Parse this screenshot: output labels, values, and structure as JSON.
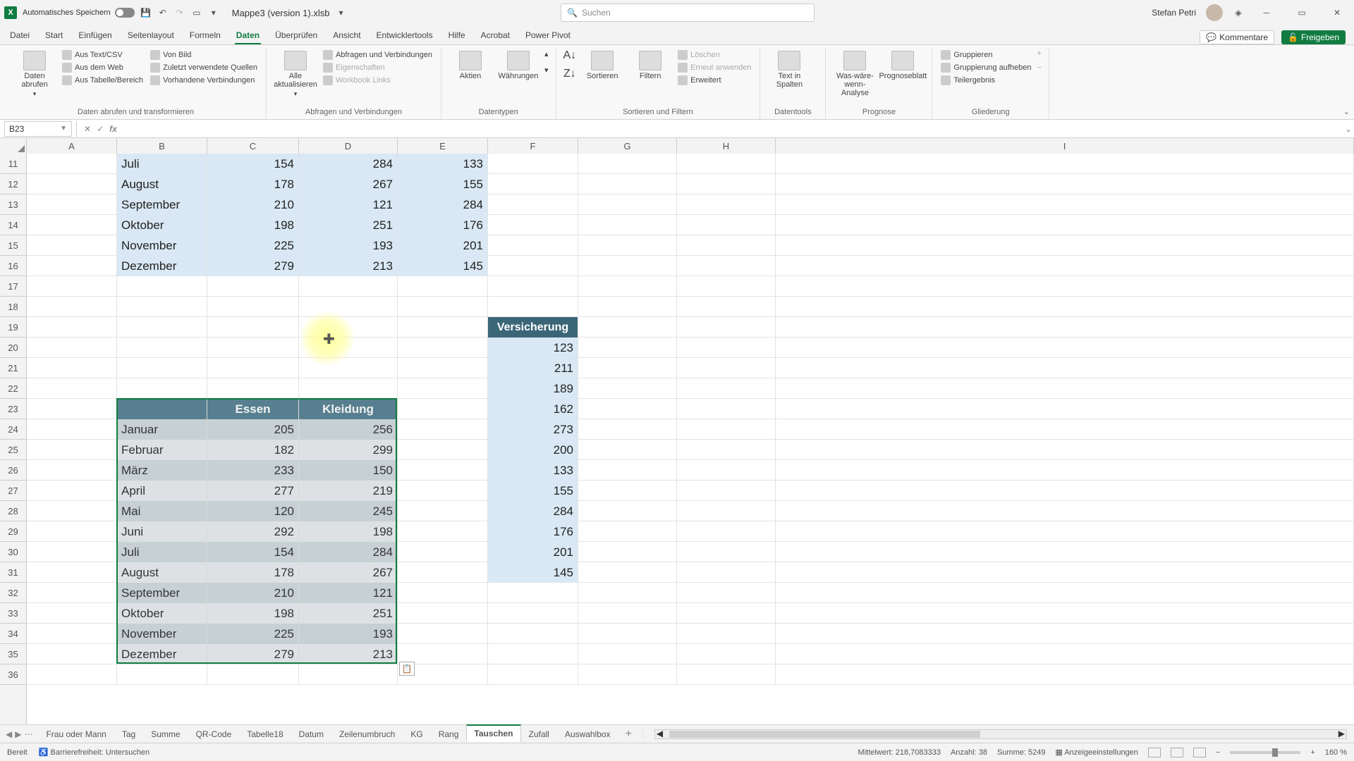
{
  "title": {
    "autosave_label": "Automatisches Speichern",
    "document_name": "Mappe3 (version 1).xlsb",
    "search_placeholder": "Suchen",
    "user_name": "Stefan Petri"
  },
  "menu": {
    "tabs": [
      "Datei",
      "Start",
      "Einfügen",
      "Seitenlayout",
      "Formeln",
      "Daten",
      "Überprüfen",
      "Ansicht",
      "Entwicklertools",
      "Hilfe",
      "Acrobat",
      "Power Pivot"
    ],
    "active_index": 5,
    "comments": "Kommentare",
    "share": "Freigeben"
  },
  "ribbon": {
    "g0_big": "Daten abrufen",
    "g0_items": [
      "Aus Text/CSV",
      "Aus dem Web",
      "Aus Tabelle/Bereich",
      "Von Bild",
      "Zuletzt verwendete Quellen",
      "Vorhandene Verbindungen"
    ],
    "g0_label": "Daten abrufen und transformieren",
    "g1_big": "Alle aktualisieren",
    "g1_items": [
      "Abfragen und Verbindungen",
      "Eigenschaften",
      "Workbook Links"
    ],
    "g1_label": "Abfragen und Verbindungen",
    "g2_items": [
      "Aktien",
      "Währungen"
    ],
    "g2_label": "Datentypen",
    "g3_sort": "Sortieren",
    "g3_filter": "Filtern",
    "g3_items": [
      "Löschen",
      "Erneut anwenden",
      "Erweitert"
    ],
    "g3_label": "Sortieren und Filtern",
    "g4_big": "Text in Spalten",
    "g4_label": "Datentools",
    "g5_a": "Was-wäre-wenn-Analyse",
    "g5_b": "Prognoseblatt",
    "g5_label": "Prognose",
    "g6_items": [
      "Gruppieren",
      "Gruppierung aufheben",
      "Teilergebnis"
    ],
    "g6_label": "Gliederung"
  },
  "fx": {
    "namebox": "B23"
  },
  "columns": [
    "A",
    "B",
    "C",
    "D",
    "E",
    "F",
    "G",
    "H",
    "I"
  ],
  "row_start": 11,
  "row_count": 26,
  "top_table": {
    "rows": [
      {
        "m": "Juli",
        "c": 154,
        "d": 284,
        "e": 133
      },
      {
        "m": "August",
        "c": 178,
        "d": 267,
        "e": 155
      },
      {
        "m": "September",
        "c": 210,
        "d": 121,
        "e": 284
      },
      {
        "m": "Oktober",
        "c": 198,
        "d": 251,
        "e": 176
      },
      {
        "m": "November",
        "c": 225,
        "d": 193,
        "e": 201
      },
      {
        "m": "Dezember",
        "c": 279,
        "d": 213,
        "e": 145
      }
    ]
  },
  "side_col": {
    "header": "Versicherung",
    "values": [
      123,
      211,
      189,
      162,
      273,
      200,
      133,
      155,
      284,
      176,
      201,
      145
    ]
  },
  "bottom_table": {
    "headers": [
      "",
      "Essen",
      "Kleidung"
    ],
    "rows": [
      {
        "m": "Januar",
        "e": 205,
        "k": 256
      },
      {
        "m": "Februar",
        "e": 182,
        "k": 299
      },
      {
        "m": "März",
        "e": 233,
        "k": 150
      },
      {
        "m": "April",
        "e": 277,
        "k": 219
      },
      {
        "m": "Mai",
        "e": 120,
        "k": 245
      },
      {
        "m": "Juni",
        "e": 292,
        "k": 198
      },
      {
        "m": "Juli",
        "e": 154,
        "k": 284
      },
      {
        "m": "August",
        "e": 178,
        "k": 267
      },
      {
        "m": "September",
        "e": 210,
        "k": 121
      },
      {
        "m": "Oktober",
        "e": 198,
        "k": 251
      },
      {
        "m": "November",
        "e": 225,
        "k": 193
      },
      {
        "m": "Dezember",
        "e": 279,
        "k": 213
      }
    ]
  },
  "sheets": {
    "tabs": [
      "Frau oder Mann",
      "Tag",
      "Summe",
      "QR-Code",
      "Tabelle18",
      "Datum",
      "Zeilenumbruch",
      "KG",
      "Rang",
      "Tauschen",
      "Zufall",
      "Auswahlbox"
    ],
    "active_index": 9
  },
  "status": {
    "ready": "Bereit",
    "access": "Barrierefreiheit: Untersuchen",
    "avg_label": "Mittelwert:",
    "avg_value": "218,7083333",
    "count_label": "Anzahl:",
    "count_value": "38",
    "sum_label": "Summe:",
    "sum_value": "5249",
    "display": "Anzeigeeinstellungen",
    "zoom": "160 %"
  }
}
